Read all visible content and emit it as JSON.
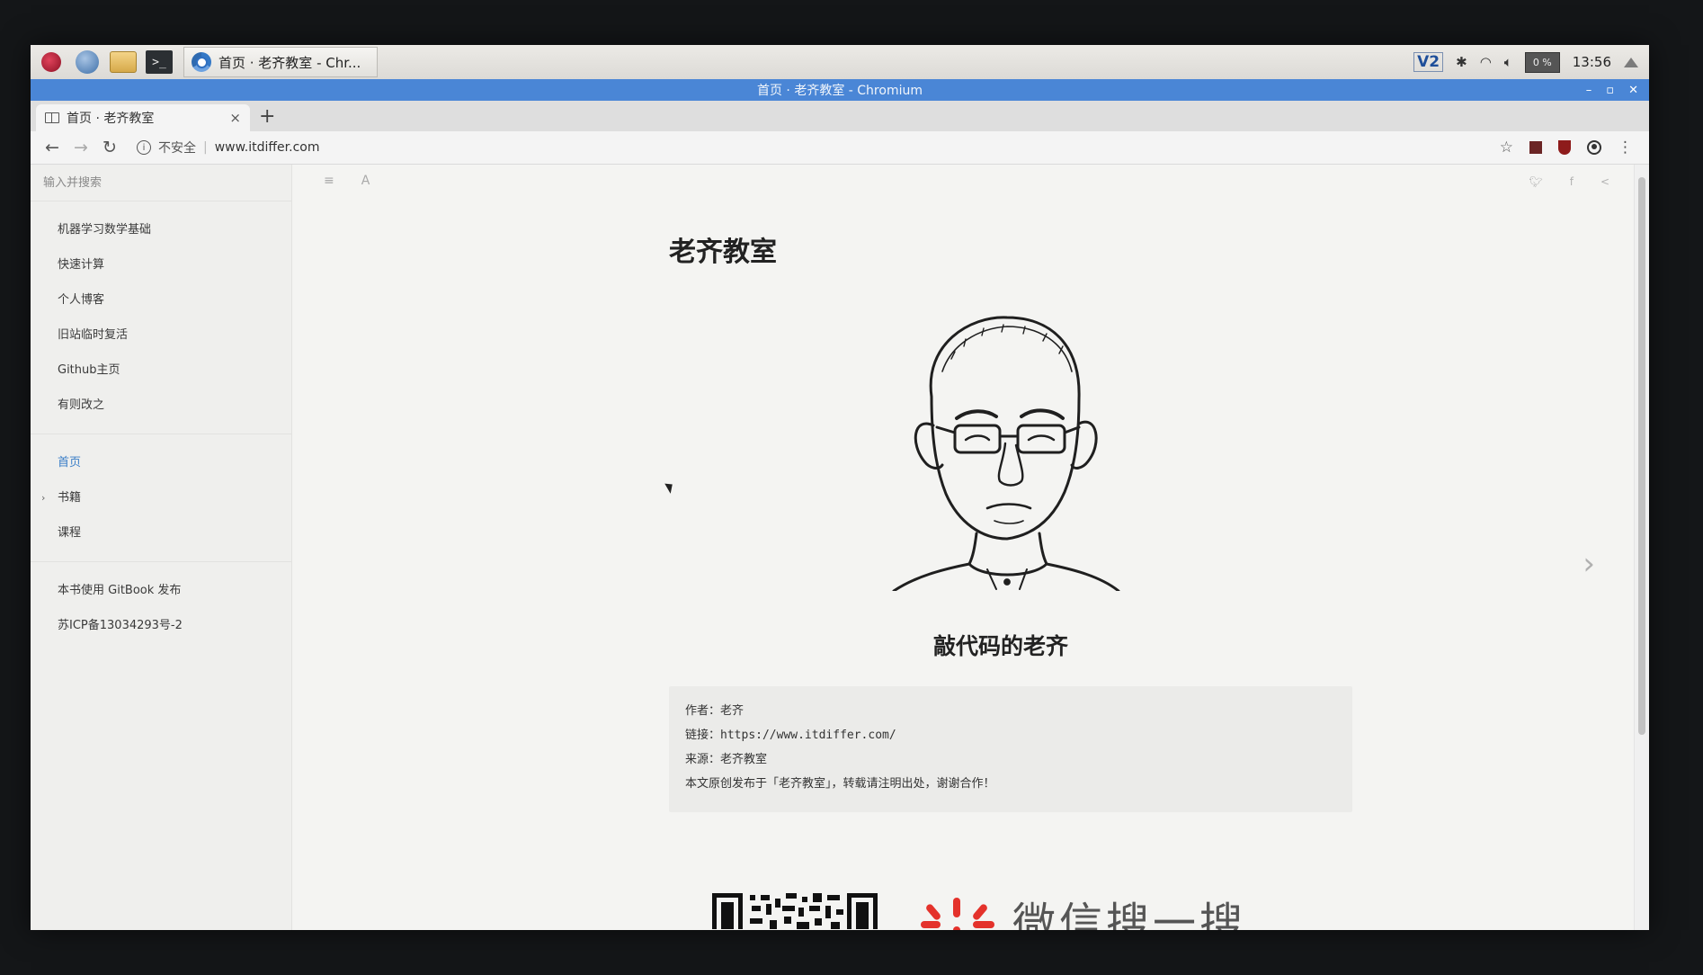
{
  "taskbar": {
    "window_button_label": "首页 · 老齐教室 - Chr...",
    "terminal_glyph": ">_",
    "v2_label": "V2",
    "cpu_label": "0 %",
    "clock": "13:56"
  },
  "window": {
    "title": "首页 · 老齐教室 - Chromium",
    "controls": [
      "–",
      "▫",
      "✕"
    ]
  },
  "tabs": [
    {
      "title": "首页 · 老齐教室",
      "close": "×"
    }
  ],
  "new_tab_label": "+",
  "toolbar": {
    "security_label": "不安全",
    "url": "www.itdiffer.com"
  },
  "sidebar": {
    "search_placeholder": "输入并搜索",
    "links": [
      "机器学习数学基础",
      "快速计算",
      "个人博客",
      "旧站临时复活",
      "Github主页",
      "有则改之"
    ],
    "nav": [
      {
        "label": "首页",
        "active": true
      },
      {
        "label": "书籍",
        "expandable": true
      },
      {
        "label": "课程"
      }
    ],
    "footer": [
      "本书使用 GitBook 发布",
      "苏ICP备13034293号-2"
    ]
  },
  "page": {
    "title": "老齐教室",
    "subtitle": "敲代码的老齐",
    "info": {
      "author_label": "作者：",
      "author": "老齐",
      "link_label": "链接：",
      "link": "https://www.itdiffer.com/",
      "source_label": "来源：",
      "source": "老齐教室",
      "notice": "本文原创发布于「老齐教室」，转载请注明出处，谢谢合作！"
    },
    "wechat_text": "微信搜一搜"
  },
  "colors": {
    "titlebar": "#4a86d6",
    "active_link": "#3a7ec7",
    "wechat_red": "#e4322b"
  }
}
